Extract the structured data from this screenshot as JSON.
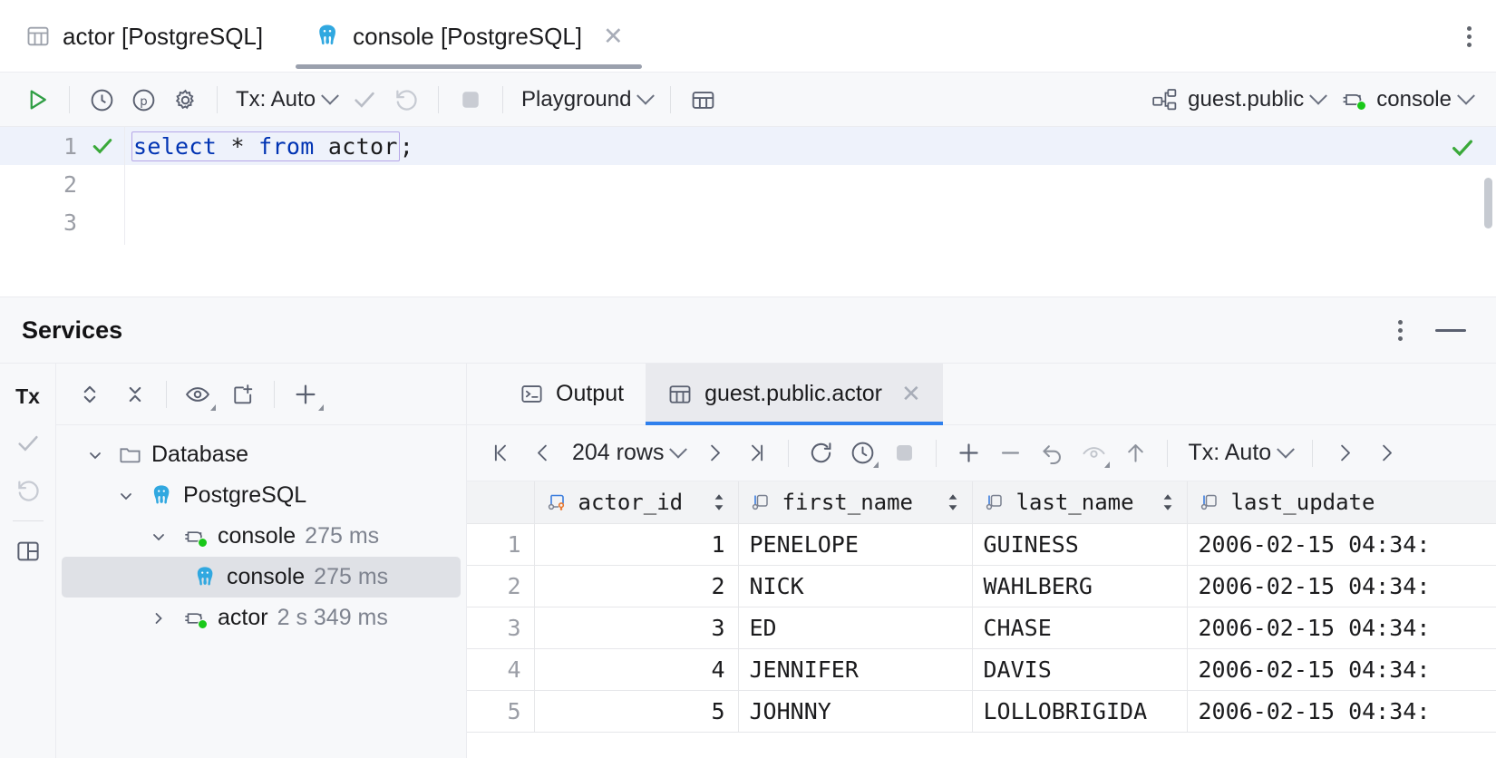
{
  "editor_tabs": [
    {
      "label": "actor [PostgreSQL]",
      "icon": "table-icon",
      "selected": false,
      "closable": false
    },
    {
      "label": "console [PostgreSQL]",
      "icon": "postgresql-elephant-icon",
      "selected": true,
      "closable": true
    }
  ],
  "editor_toolbar": {
    "run_label": "run-query",
    "tx_label": "Tx: Auto",
    "schema_label": "Playground",
    "datasource_label": "guest.public",
    "session_label": "console",
    "icons": [
      "run-icon",
      "history-icon",
      "parameters-icon",
      "settings-icon",
      "commit-icon",
      "rollback-icon",
      "stop-icon",
      "table-editor-icon"
    ]
  },
  "code": {
    "lines": [
      "1",
      "2",
      "3"
    ],
    "statement": {
      "kw1": "select",
      "star": " * ",
      "kw2": "from",
      "table": " actor",
      "semi": ";"
    },
    "full_text": "select * from actor;"
  },
  "services": {
    "title": "Services",
    "left_rail": [
      "Tx",
      "commit-icon",
      "rollback-icon",
      "layout-icon"
    ],
    "tree_toolbar_icons": [
      "expand-collapse-icon",
      "collapse-all-icon",
      "preview-icon",
      "new-tab-icon",
      "add-icon"
    ],
    "tree": [
      {
        "label": "Database",
        "icon": "folder-icon",
        "indent": 0,
        "expanded": true,
        "time": "",
        "selected": false
      },
      {
        "label": "PostgreSQL",
        "icon": "postgresql-elephant-icon",
        "indent": 1,
        "expanded": true,
        "time": "",
        "selected": false
      },
      {
        "label": "console",
        "icon": "connection-icon",
        "indent": 2,
        "expanded": true,
        "time": "275 ms",
        "selected": false
      },
      {
        "label": "console",
        "icon": "postgresql-elephant-icon",
        "indent": 3,
        "expanded": null,
        "time": "275 ms",
        "selected": true
      },
      {
        "label": "actor",
        "icon": "connection-icon",
        "indent": 2,
        "expanded": false,
        "time": "2 s 349 ms",
        "selected": false
      }
    ]
  },
  "result": {
    "tabs": [
      {
        "label": "Output",
        "icon": "console-output-icon",
        "selected": false,
        "closable": false
      },
      {
        "label": "guest.public.actor",
        "icon": "table-icon",
        "selected": true,
        "closable": true
      }
    ],
    "grid_toolbar": {
      "rows_label": "204 rows",
      "tx_label": "Tx: Auto",
      "icons": [
        "first-page-icon",
        "prev-page-icon",
        "next-page-icon",
        "last-page-icon",
        "reload-icon",
        "auto-refresh-icon",
        "stop-icon",
        "add-row-icon",
        "delete-row-icon",
        "revert-icon",
        "revert-selected-icon",
        "submit-icon",
        "expand-icon",
        "next-icon"
      ]
    },
    "columns": [
      {
        "name": "actor_id",
        "icon": "primary-key-icon",
        "sortable": true
      },
      {
        "name": "first_name",
        "icon": "column-icon",
        "sortable": true
      },
      {
        "name": "last_name",
        "icon": "column-icon",
        "sortable": true
      },
      {
        "name": "last_update",
        "icon": "column-icon",
        "sortable": false
      }
    ],
    "rows": [
      {
        "n": "1",
        "actor_id": "1",
        "first_name": "PENELOPE",
        "last_name": "GUINESS",
        "last_update": "2006-02-15 04:34:"
      },
      {
        "n": "2",
        "actor_id": "2",
        "first_name": "NICK",
        "last_name": "WAHLBERG",
        "last_update": "2006-02-15 04:34:"
      },
      {
        "n": "3",
        "actor_id": "3",
        "first_name": "ED",
        "last_name": "CHASE",
        "last_update": "2006-02-15 04:34:"
      },
      {
        "n": "4",
        "actor_id": "4",
        "first_name": "JENNIFER",
        "last_name": "DAVIS",
        "last_update": "2006-02-15 04:34:"
      },
      {
        "n": "5",
        "actor_id": "5",
        "first_name": "JOHNNY",
        "last_name": "LOLLOBRIGIDA",
        "last_update": "2006-02-15 04:34:"
      }
    ]
  },
  "colors": {
    "accent_blue": "#2f80ed",
    "keyword_blue": "#0033b3",
    "success_green": "#3aa93a",
    "status_green": "#19c819",
    "elephant_blue": "#31a8e0",
    "selection_purple": "#b6a7e8"
  }
}
